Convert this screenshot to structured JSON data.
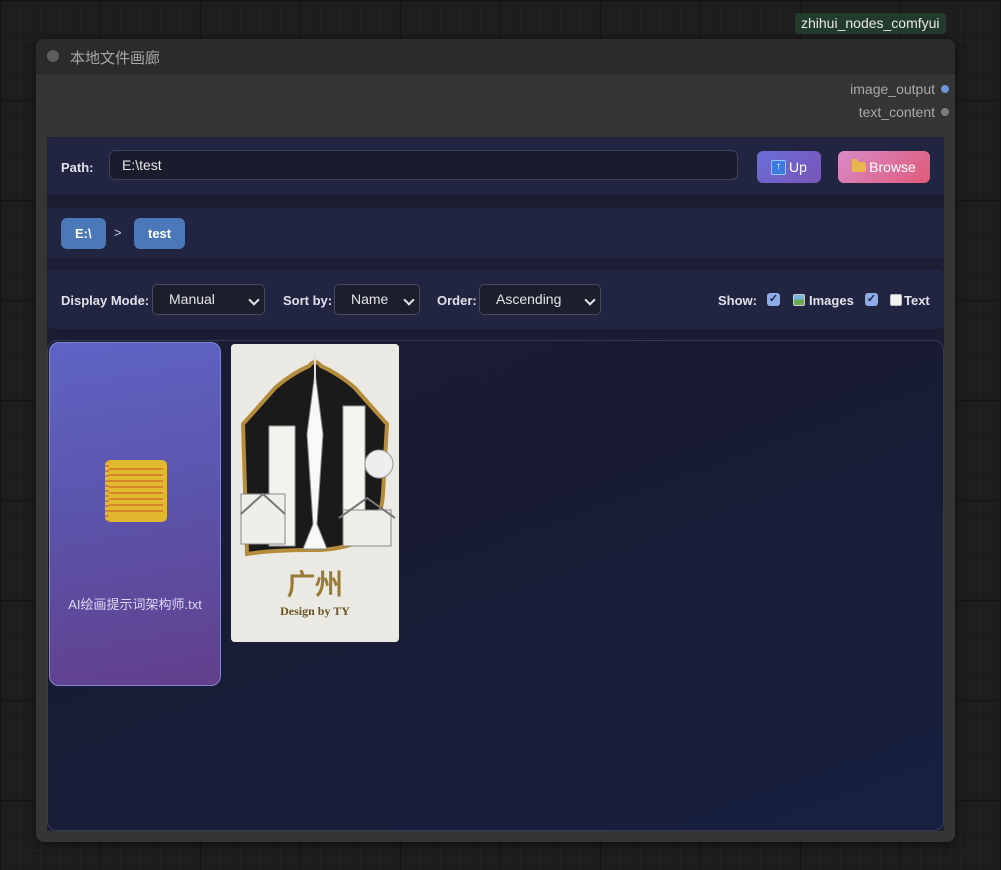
{
  "badge": {
    "text": "zhihui_nodes_comfyui"
  },
  "node": {
    "title": "本地文件画廊",
    "outputs": [
      {
        "label": "image_output",
        "color": "#6f97d8"
      },
      {
        "label": "text_content",
        "color": "#7d7d7d"
      }
    ]
  },
  "path_bar": {
    "label": "Path:",
    "value": "E:\\test",
    "up_label": "Up",
    "browse_label": "Browse"
  },
  "breadcrumb": {
    "items": [
      "E:\\",
      "test"
    ],
    "separator": ">"
  },
  "controls": {
    "display_mode_label": "Display Mode:",
    "display_mode_value": "Manual",
    "sort_label": "Sort by:",
    "sort_value": "Name",
    "order_label": "Order:",
    "order_value": "Ascending",
    "show_label": "Show:",
    "images_label": "Images",
    "images_checked": true,
    "text_label": "Text",
    "text_checked": true
  },
  "files": [
    {
      "type": "text",
      "name": "AI绘画提示词架构师.txt",
      "icon": "notepad-icon"
    },
    {
      "type": "image",
      "poster_title": "广州",
      "poster_subtitle": "Design by TY"
    }
  ],
  "colors": {
    "accent_chip": "#4a78b8",
    "up_button": "#6a6ed8",
    "browse_button": "#e05a78"
  }
}
